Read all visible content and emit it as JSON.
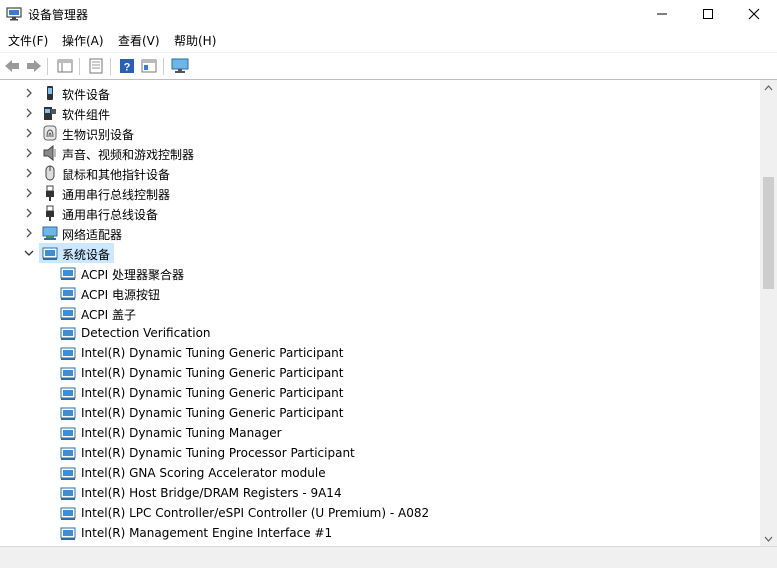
{
  "window": {
    "title": "设备管理器"
  },
  "menu": [
    "文件(F)",
    "操作(A)",
    "查看(V)",
    "帮助(H)"
  ],
  "toolbar": {
    "buttons": [
      "back-icon",
      "forward-icon",
      "properties-icon",
      "update-icon",
      "help-icon",
      "view-icon",
      "monitor-icon"
    ]
  },
  "tree": {
    "categories": [
      {
        "label": "软件设备",
        "icon": "software-device-icon",
        "expanded": false
      },
      {
        "label": "软件组件",
        "icon": "software-component-icon",
        "expanded": false
      },
      {
        "label": "生物识别设备",
        "icon": "fingerprint-icon",
        "expanded": false
      },
      {
        "label": "声音、视频和游戏控制器",
        "icon": "speaker-icon",
        "expanded": false
      },
      {
        "label": "鼠标和其他指针设备",
        "icon": "mouse-icon",
        "expanded": false
      },
      {
        "label": "通用串行总线控制器",
        "icon": "usb-icon",
        "expanded": false
      },
      {
        "label": "通用串行总线设备",
        "icon": "usb-icon",
        "expanded": false
      },
      {
        "label": "网络适配器",
        "icon": "network-adapter-icon",
        "expanded": false
      },
      {
        "label": "系统设备",
        "icon": "system-device-icon",
        "expanded": true,
        "selected": true
      }
    ],
    "system_devices": [
      "ACPI 处理器聚合器",
      "ACPI 电源按钮",
      "ACPI 盖子",
      "Detection Verification",
      "Intel(R) Dynamic Tuning Generic Participant",
      "Intel(R) Dynamic Tuning Generic Participant",
      "Intel(R) Dynamic Tuning Generic Participant",
      "Intel(R) Dynamic Tuning Generic Participant",
      "Intel(R) Dynamic Tuning Manager",
      "Intel(R) Dynamic Tuning Processor Participant",
      "Intel(R) GNA Scoring Accelerator module",
      "Intel(R) Host Bridge/DRAM Registers - 9A14",
      "Intel(R) LPC Controller/eSPI Controller (U Premium) - A082",
      "Intel(R) Management Engine Interface #1"
    ]
  }
}
